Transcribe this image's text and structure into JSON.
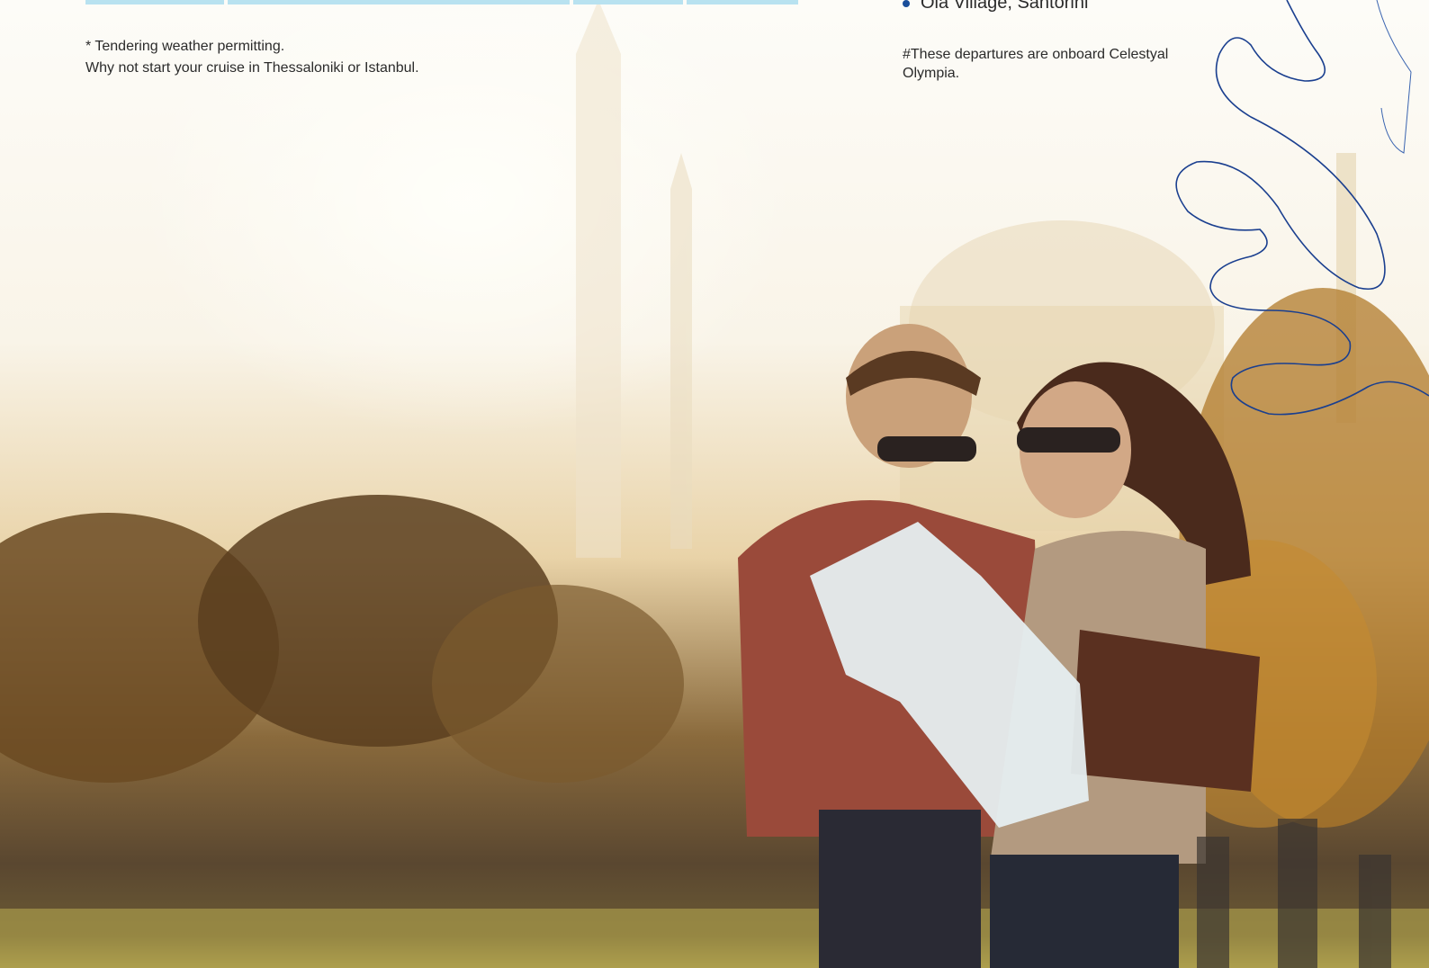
{
  "footnotes": {
    "tendering": "* Tendering weather permitting.",
    "alternative_start": "Why not start your cruise in Thessaloniki or Istanbul."
  },
  "list": {
    "last_item": "Oia Village, Santorini",
    "bullet_color": "#1a4e9a"
  },
  "departures_note": "#These departures are onboard Celestyal Olympia.",
  "colors": {
    "table_accent": "#b8e2f0",
    "swirl_line": "#1a3f8f"
  },
  "photo": {
    "subject": "couple-reading-map-photo",
    "background": "mosque-minarets-and-trees"
  }
}
